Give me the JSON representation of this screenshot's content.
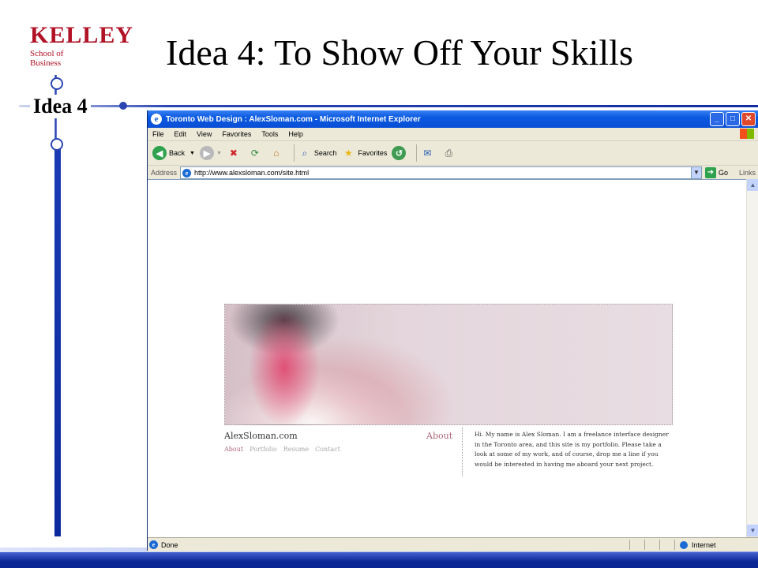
{
  "slide": {
    "logo_big": "KELLEY",
    "logo_small": "School of Business",
    "title": "Idea 4: To Show Off Your Skills",
    "section_label": "Idea 4"
  },
  "browser": {
    "title": "Toronto Web Design : AlexSloman.com - Microsoft Internet Explorer",
    "menu": [
      "File",
      "Edit",
      "View",
      "Favorites",
      "Tools",
      "Help"
    ],
    "toolbar": {
      "back": "Back",
      "search": "Search",
      "favorites": "Favorites"
    },
    "address_label": "Address",
    "address_value": "http://www.alexsloman.com/site.html",
    "go_label": "Go",
    "links_label": "Links",
    "status_text": "Done",
    "zone_text": "Internet"
  },
  "website": {
    "site_name": "AlexSloman.com",
    "about_heading": "About",
    "nav": [
      "About",
      "Portfolio",
      "Resume",
      "Contact"
    ],
    "bio": "Hi. My name is Alex Sloman. I am a freelance interface designer in the Toronto area, and this site is my portfolio. Please take a look at some of my work, and of course, drop me a line if you would be interested in having me aboard your next project."
  },
  "colors": {
    "kelley_red": "#b11226",
    "slide_blue": "#1a3bb4",
    "xp_title_blue": "#0a5ae0",
    "site_accent": "#b0657a"
  }
}
